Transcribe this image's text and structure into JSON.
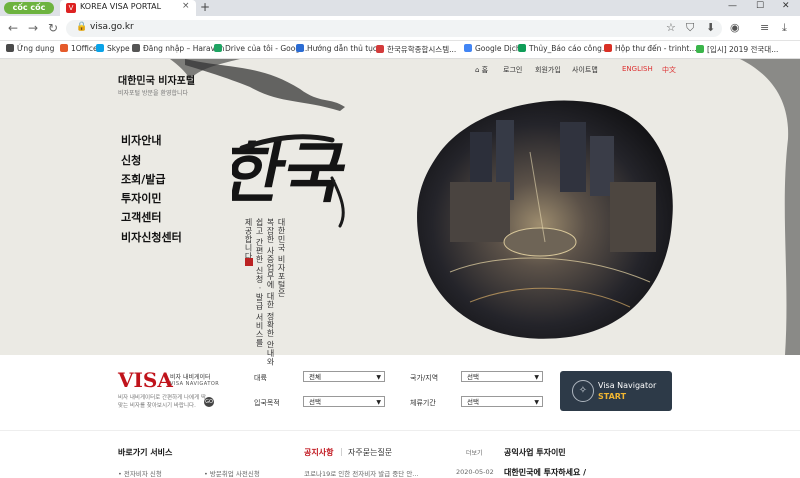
{
  "browser": {
    "brand": "cốc cốc",
    "tab_title": "KOREA VISA PORTAL",
    "tab_close": "×",
    "new_tab": "+",
    "url": "visa.go.kr",
    "window_buttons": [
      "—",
      "☐",
      "✕"
    ],
    "bookmarks": [
      {
        "label": "Ứng dụng",
        "color": "#4a4a4a"
      },
      {
        "label": "1Office",
        "color": "#e55b2b"
      },
      {
        "label": "Skype",
        "color": "#0aa3e8"
      },
      {
        "label": "Đăng nhập – Haravan",
        "color": "#555555"
      },
      {
        "label": "Drive của tôi - Goog...",
        "color": "#1fa463"
      },
      {
        "label": "Hướng dẫn thủ tục...",
        "color": "#2b6cd4"
      },
      {
        "label": "한국유학종합시스템...",
        "color": "#d33b3b"
      },
      {
        "label": "Google Dịch",
        "color": "#4285f4"
      },
      {
        "label": "Thủy_Báo cáo công...",
        "color": "#0f9d58"
      },
      {
        "label": "Hộp thư đến - trinht...",
        "color": "#d93025"
      },
      {
        "label": "[입시] 2019 전국대...",
        "color": "#3ab54a"
      }
    ]
  },
  "portal": {
    "title": "대한민국 비자포털",
    "subtitle": "비자포털 방문을 환영합니다",
    "menu": [
      "비자안내",
      "신청",
      "조회/발급",
      "투자이민",
      "고객센터",
      "비자신청센터"
    ],
    "topnav": {
      "home": "홈",
      "login": "로그인",
      "signup": "회원가입",
      "sitemap": "사이트맵",
      "english": "ENGLISH",
      "chinese": "中文"
    },
    "calligraphy": "한국",
    "vertical_lines": [
      "대한민국 비자포털은",
      "복잡한 사증업무에 대한 정확한 안내와",
      "쉽고 간편한 신청 · 발급 서비스를",
      "제공합니다"
    ]
  },
  "visa_navigator": {
    "logo": "VISA",
    "korean": "비자 내비게이터",
    "english": "VISA NAVIGATOR",
    "description": "비자 내비게이터로 간편하게 나에게 딱 맞는 비자를 찾아보시기 바랍니다.",
    "go": "GO",
    "fields": [
      {
        "label": "대륙",
        "value": "전체"
      },
      {
        "label": "국가/지역",
        "value": "선택"
      },
      {
        "label": "입국목적",
        "value": "선택"
      },
      {
        "label": "체류기간",
        "value": "선택"
      }
    ],
    "button_line1": "Visa Navigator",
    "button_line2": "START"
  },
  "bottom": {
    "shortcut": "바로가기 서비스",
    "notice": "공지사항",
    "faq": "자주묻는질문",
    "more": "더보기",
    "invest": "공익사업 투자이민",
    "peek": [
      "• 전자비자 신청",
      "• 방문취업 사전신청",
      "코로나19로 인한 전자비자 발급 중단 안...",
      "2020-05-02",
      "대한민국에 투자하세요 /"
    ]
  },
  "colors": {
    "accent_red": "#c0131b",
    "button_dark": "#2d3a48",
    "start_yellow": "#f1b632"
  }
}
